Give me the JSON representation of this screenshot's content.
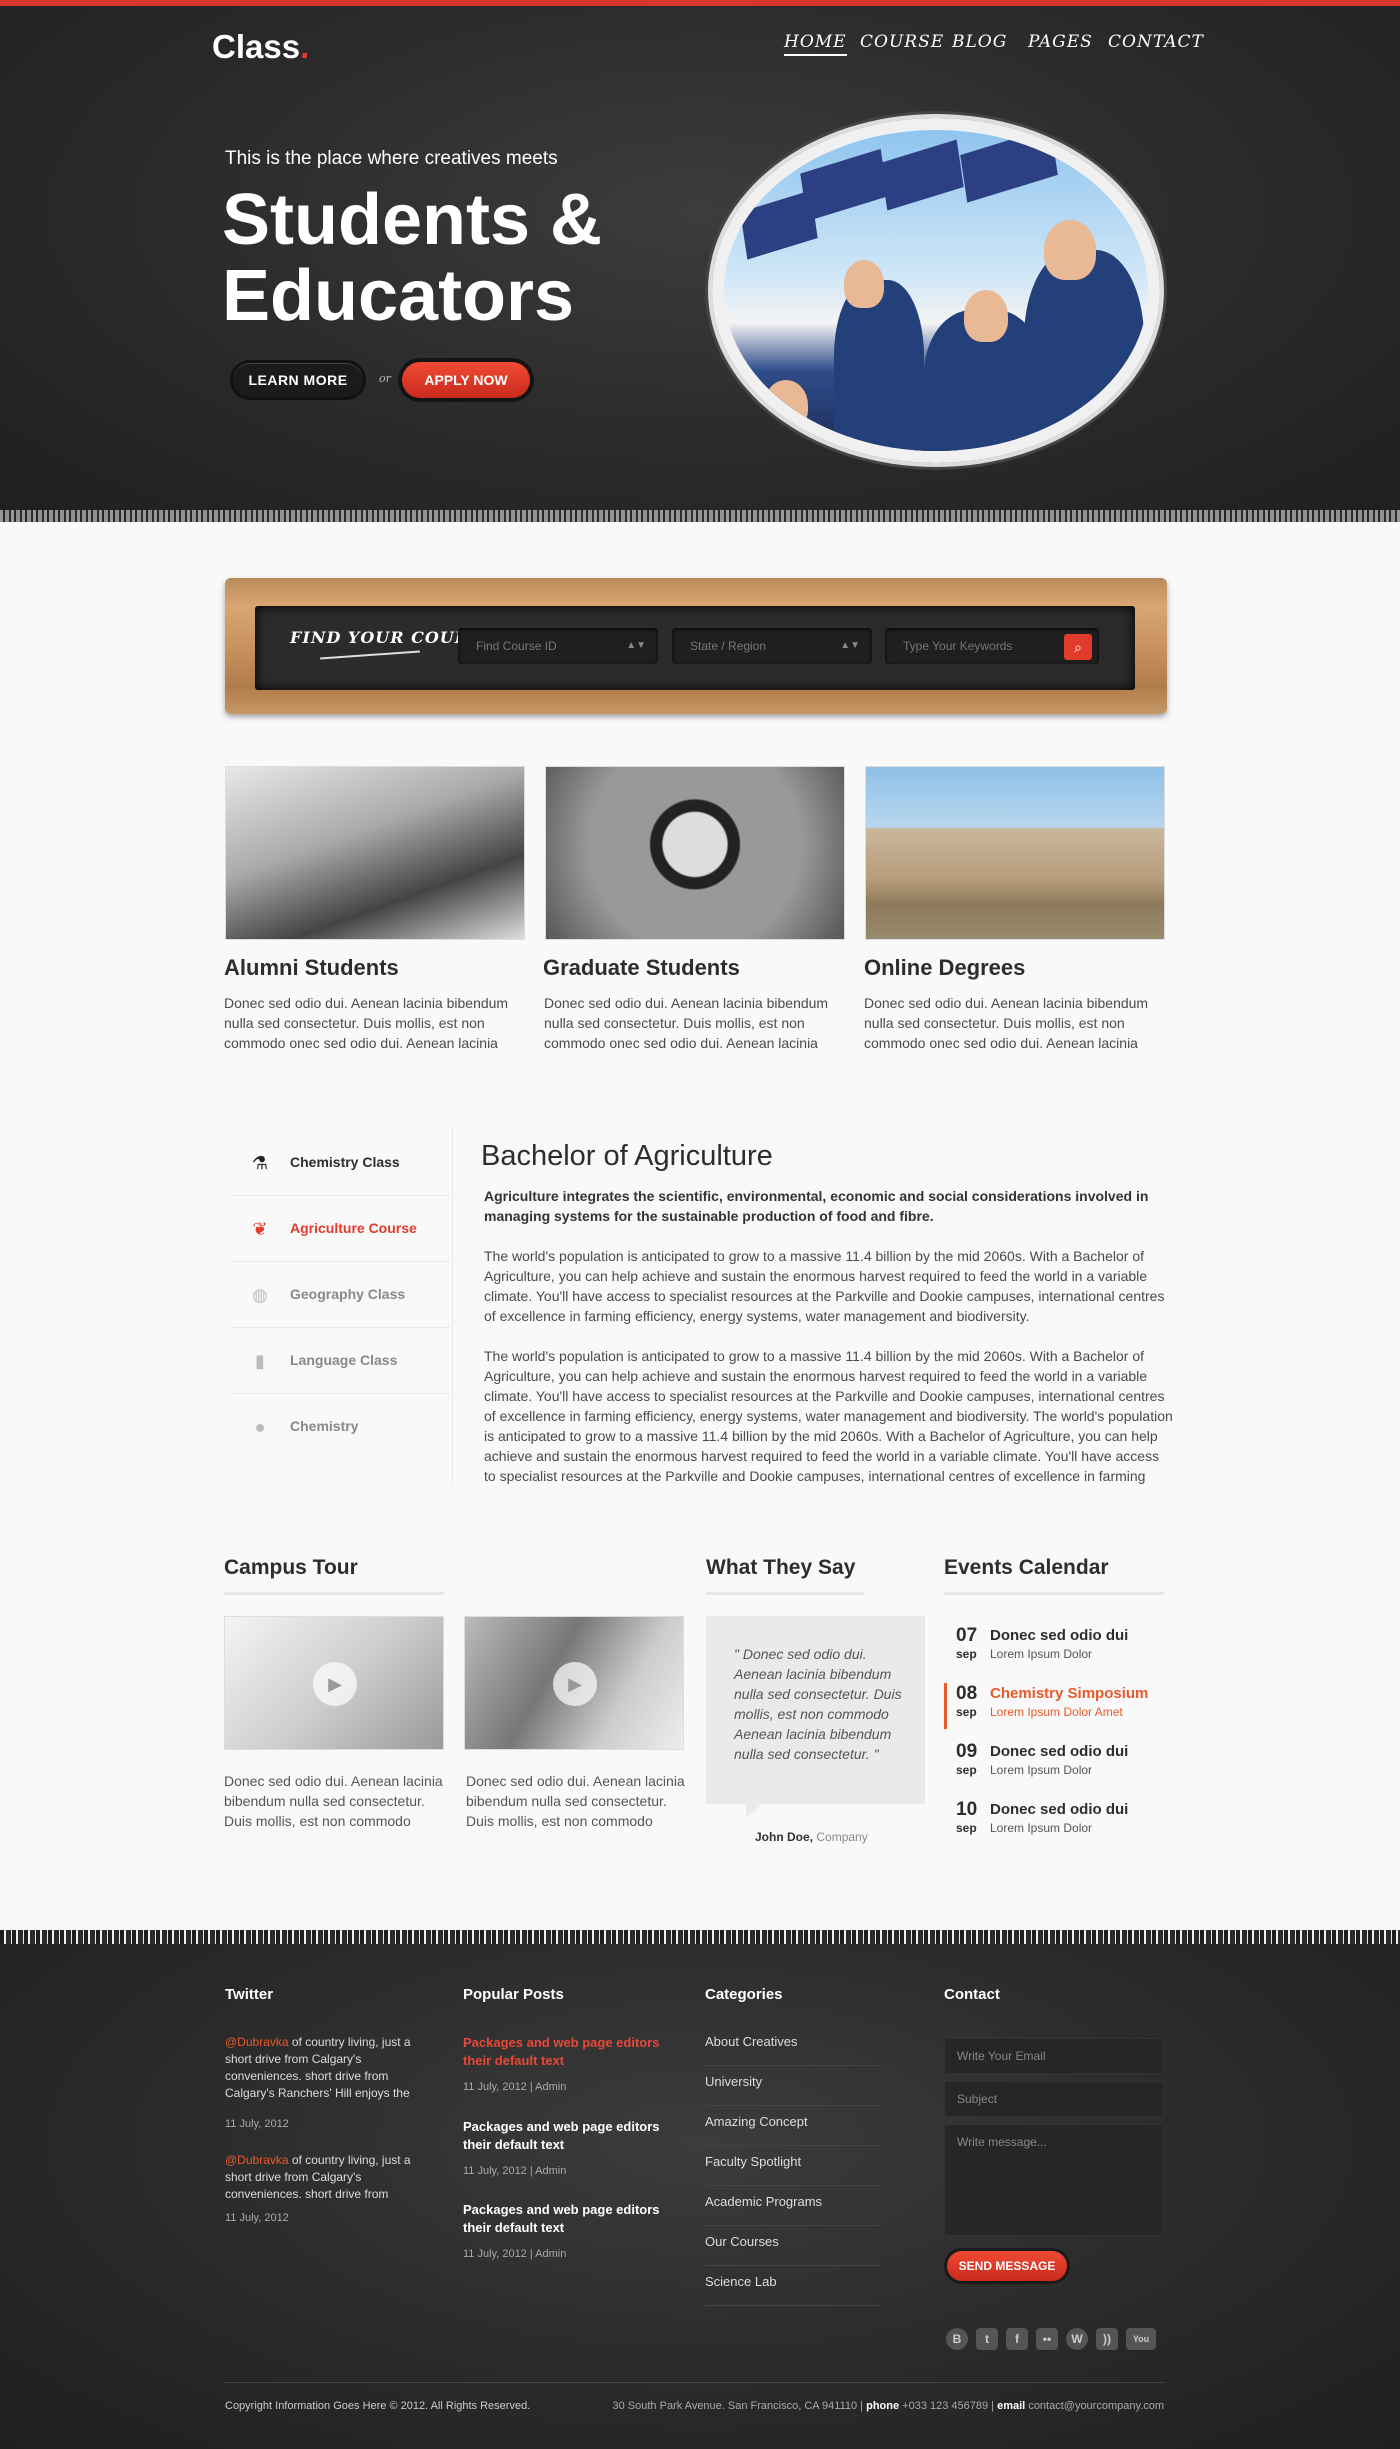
{
  "brand": {
    "name": "Class",
    "dot": ".",
    "accent": "#e23a2c"
  },
  "nav": {
    "items": [
      "HOME",
      "COURSE",
      "BLOG",
      "PAGES",
      "CONTACT"
    ]
  },
  "hero": {
    "tagline": "This is the place where creatives meets",
    "title": "Students & Educators",
    "learn_more": "LEARN  MORE",
    "or": "or",
    "apply_now": "APPLY NOW"
  },
  "search": {
    "label": "FIND YOUR COURSE:",
    "course_id_placeholder": "Find Course ID",
    "region_placeholder": "State / Region",
    "keywords_placeholder": "Type Your Keywords"
  },
  "features": [
    {
      "title": "Alumni Students",
      "text": "Donec sed odio dui. Aenean lacinia bibendum nulla sed consectetur. Duis mollis, est non commodo onec sed odio dui. Aenean lacinia"
    },
    {
      "title": "Graduate Students",
      "text": "Donec sed odio dui. Aenean lacinia bibendum nulla sed consectetur. Duis mollis, est non commodo onec sed odio dui. Aenean lacinia"
    },
    {
      "title": "Online Degrees",
      "text": "Donec sed odio dui. Aenean lacinia bibendum nulla sed consectetur. Duis mollis, est non commodo onec sed odio dui. Aenean lacinia"
    }
  ],
  "tabs": [
    {
      "label": "Chemistry Class",
      "icon": "flask-icon"
    },
    {
      "label": "Agriculture Course",
      "icon": "leaf-icon"
    },
    {
      "label": "Geography Class",
      "icon": "globe-icon"
    },
    {
      "label": "Language Class",
      "icon": "book-icon"
    },
    {
      "label": "Chemistry",
      "icon": "microscope-icon"
    }
  ],
  "article": {
    "title": "Bachelor of Agriculture",
    "lead": "Agriculture integrates the scientific, environmental, economic and social considerations involved in managing systems for the sustainable production of food and fibre.",
    "p1": "The world's population is anticipated to grow to a massive 11.4 billion by the mid 2060s. With a Bachelor of Agriculture, you can help achieve and sustain the enormous harvest required to feed the world in a variable climate. You'll have access to specialist resources at the Parkville and Dookie campuses, international centres of excellence in farming efficiency, energy systems, water management and biodiversity.",
    "p2": "The world's population is anticipated to grow to a massive 11.4 billion by the mid 2060s. With a Bachelor of Agriculture, you can help achieve and sustain the enormous harvest required to feed the world in a variable climate. You'll have access to specialist resources at the Parkville and Dookie campuses, international centres of excellence in farming efficiency, energy systems, water management and biodiversity. The world's population is anticipated to grow to a massive 11.4 billion by the mid 2060s. With a Bachelor of Agriculture, you can help achieve and sustain the enormous harvest required to feed the world in a variable climate. You'll have access to specialist resources at the Parkville and Dookie campuses, international centres of excellence in farming efficiency, energy systems, water management and"
  },
  "campus": {
    "title": "Campus Tour",
    "videos": [
      {
        "text": "Donec sed odio dui. Aenean lacinia bibendum nulla sed consectetur. Duis mollis, est non commodo"
      },
      {
        "text": "Donec sed odio dui. Aenean lacinia bibendum nulla sed consectetur. Duis mollis, est non commodo"
      }
    ]
  },
  "testimonial": {
    "title": "What They Say",
    "quote": "\" Donec sed odio dui. Aenean lacinia bibendum nulla sed consectetur. Duis mollis, est non commodo Aenean lacinia bibendum nulla sed consectetur. \"",
    "author": "John Doe,",
    "company": "Company"
  },
  "events": {
    "title": "Events Calendar",
    "items": [
      {
        "day": "07",
        "month": "sep",
        "title": "Donec sed odio dui",
        "sub": "Lorem Ipsum Dolor"
      },
      {
        "day": "08",
        "month": "sep",
        "title": "Chemistry Simposium",
        "sub": "Lorem Ipsum Dolor Amet"
      },
      {
        "day": "09",
        "month": "sep",
        "title": "Donec sed odio dui",
        "sub": "Lorem Ipsum Dolor"
      },
      {
        "day": "10",
        "month": "sep",
        "title": "Donec sed odio dui",
        "sub": "Lorem Ipsum Dolor"
      }
    ]
  },
  "footer": {
    "twitter": {
      "title": "Twitter",
      "tweets": [
        {
          "handle": "@Dubravka",
          "text": " of country living, just a short drive from Calgary's conveniences. short drive from Calgary's Ranchers' Hill enjoys the",
          "date": "11 July, 2012"
        },
        {
          "handle": "@Dubravka",
          "text": " of country living, just a short drive from Calgary's conveniences. short drive from",
          "date": "11 July, 2012"
        }
      ]
    },
    "popular": {
      "title": "Popular Posts",
      "posts": [
        {
          "title": "Packages and web page editors their default text",
          "meta": "11 July, 2012 | Admin"
        },
        {
          "title": "Packages and web page editors their default text",
          "meta": "11 July, 2012 | Admin"
        },
        {
          "title": "Packages and web page editors their default text",
          "meta": "11 July, 2012 | Admin"
        }
      ]
    },
    "categories": {
      "title": "Categories",
      "items": [
        "About Creatives",
        "University",
        "Amazing Concept",
        "Faculty Spotlight",
        "Academic Programs",
        "Our Courses",
        "Science Lab"
      ]
    },
    "contact": {
      "title": "Contact",
      "email_placeholder": "Write Your Email",
      "subject_placeholder": "Subject",
      "message_placeholder": "Write message...",
      "send": "SEND MESSAGE"
    },
    "social": [
      "B",
      "t",
      "f",
      "••",
      "W",
      "))",
      "You"
    ],
    "copyright": "Copyright Information Goes Here © 2012. All Rights Reserved.",
    "address": "30 South Park Avenue. San Francisco, CA 941110 |",
    "phone_label": "phone",
    "phone": "+033 123 456789 |",
    "email_label": "email",
    "email": "contact@yourcompany.com"
  }
}
